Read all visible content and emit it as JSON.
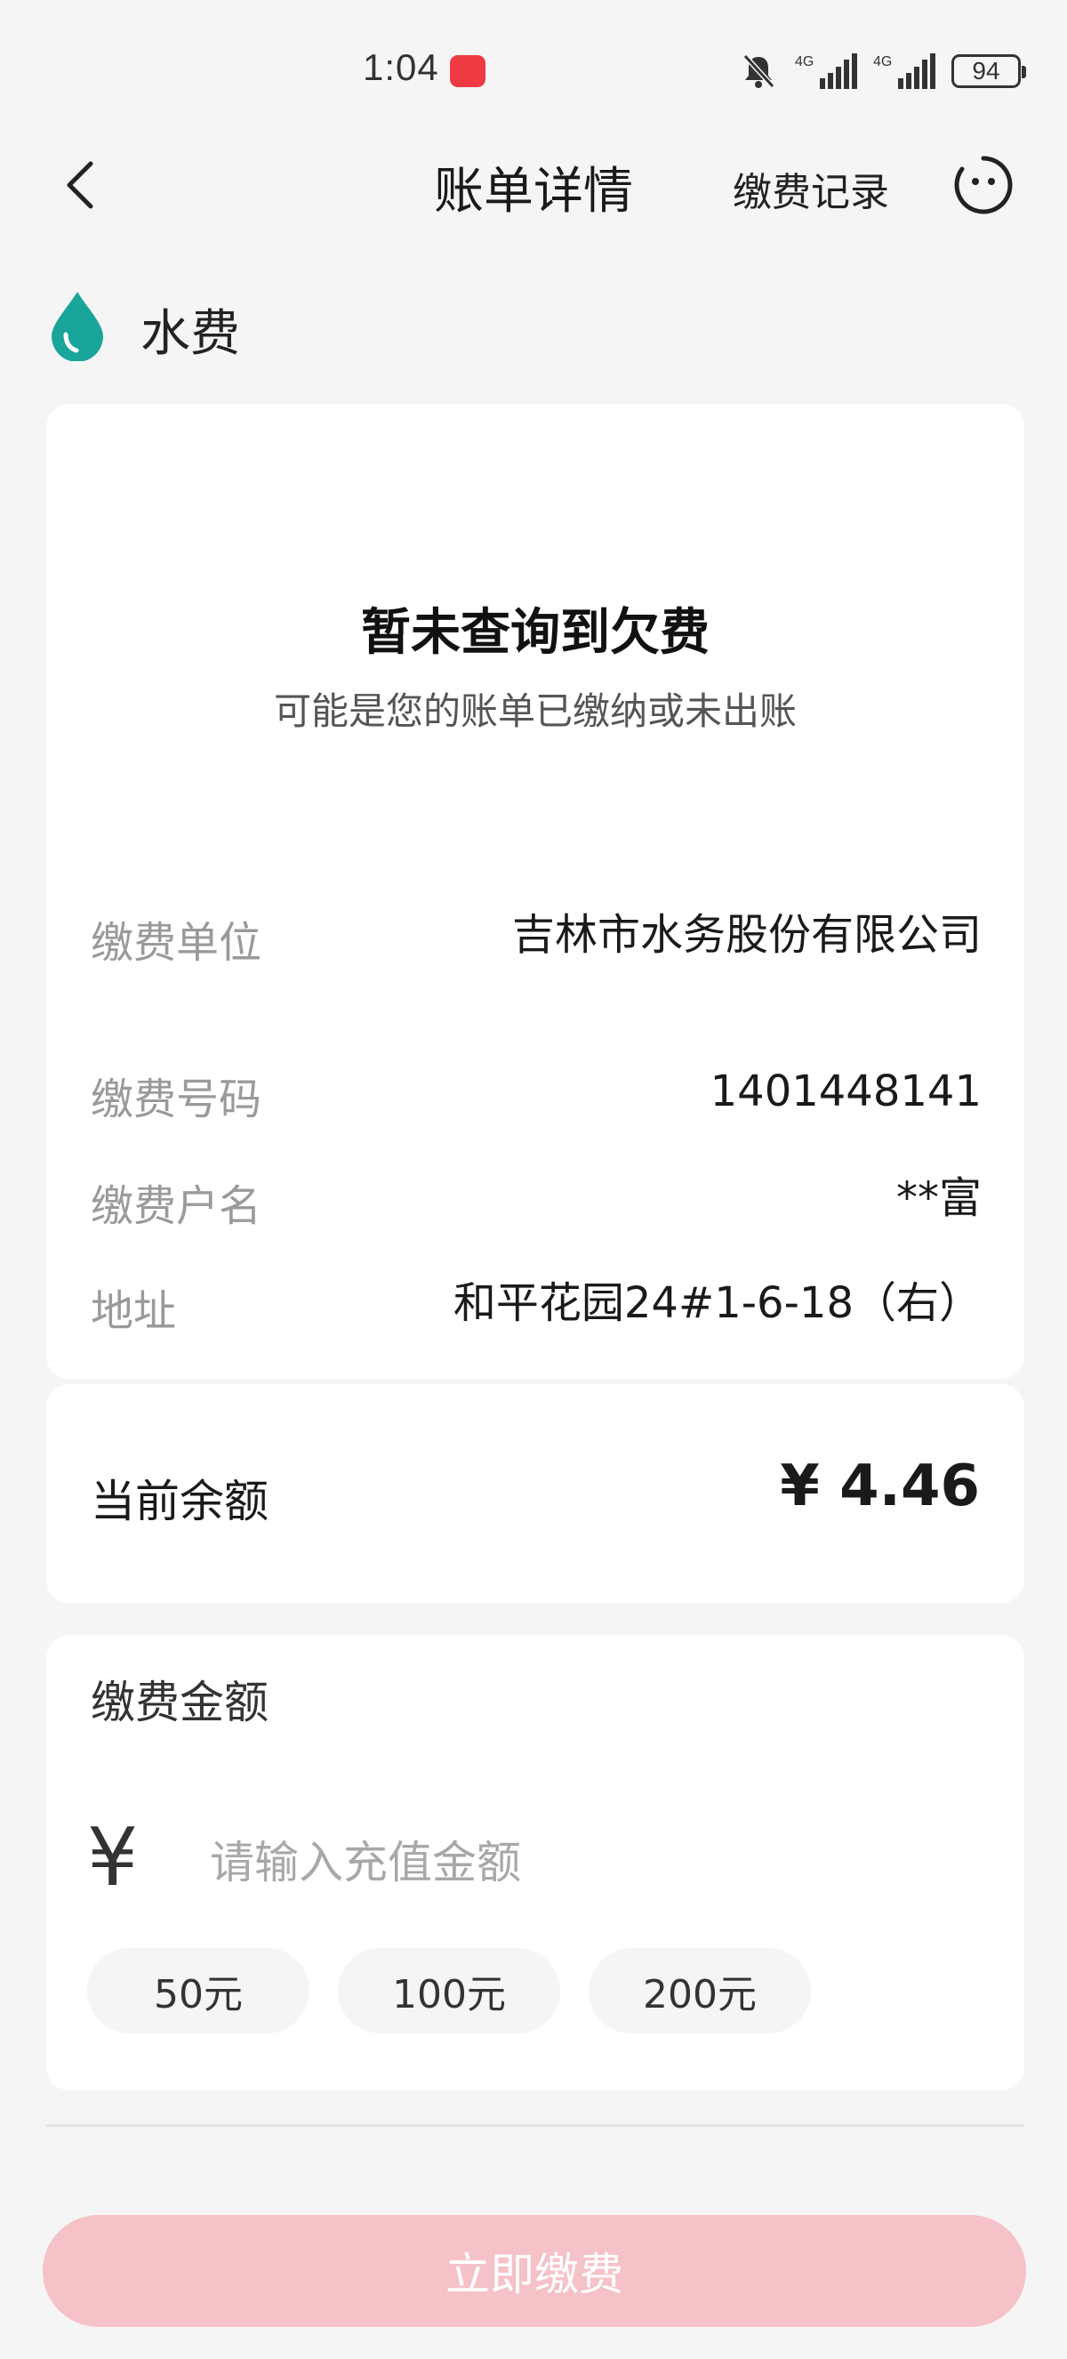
{
  "status_bar": {
    "time": "1:04",
    "network_1": "4G",
    "network_2": "4G",
    "battery": "94"
  },
  "header": {
    "title": "账单详情",
    "record_link": "缴费记录"
  },
  "section": {
    "title": "水费"
  },
  "bill": {
    "empty_title": "暂未查询到欠费",
    "empty_subtitle": "可能是您的账单已缴纳或未出账",
    "rows": [
      {
        "label": "缴费单位",
        "value": "吉林市水务股份有限公司"
      },
      {
        "label": "缴费号码",
        "value": "1401448141"
      },
      {
        "label": "缴费户名",
        "value": "**富"
      },
      {
        "label": "地址",
        "value": "和平花园24#1-6-18（右）"
      }
    ]
  },
  "balance": {
    "label": "当前余额",
    "value": "¥ 4.46"
  },
  "payment": {
    "title": "缴费金额",
    "currency": "¥",
    "placeholder": "请输入充值金额",
    "presets": [
      "50元",
      "100元",
      "200元"
    ]
  },
  "submit": {
    "label": "立即缴费"
  },
  "colors": {
    "accent_teal": "#1aa59a",
    "button_disabled_pink": "#f5c2c7",
    "badge_red": "#ef3a43"
  },
  "icons": [
    "back-arrow-icon",
    "smile-icon",
    "water-drop-icon",
    "mute-icon",
    "signal-icon"
  ]
}
